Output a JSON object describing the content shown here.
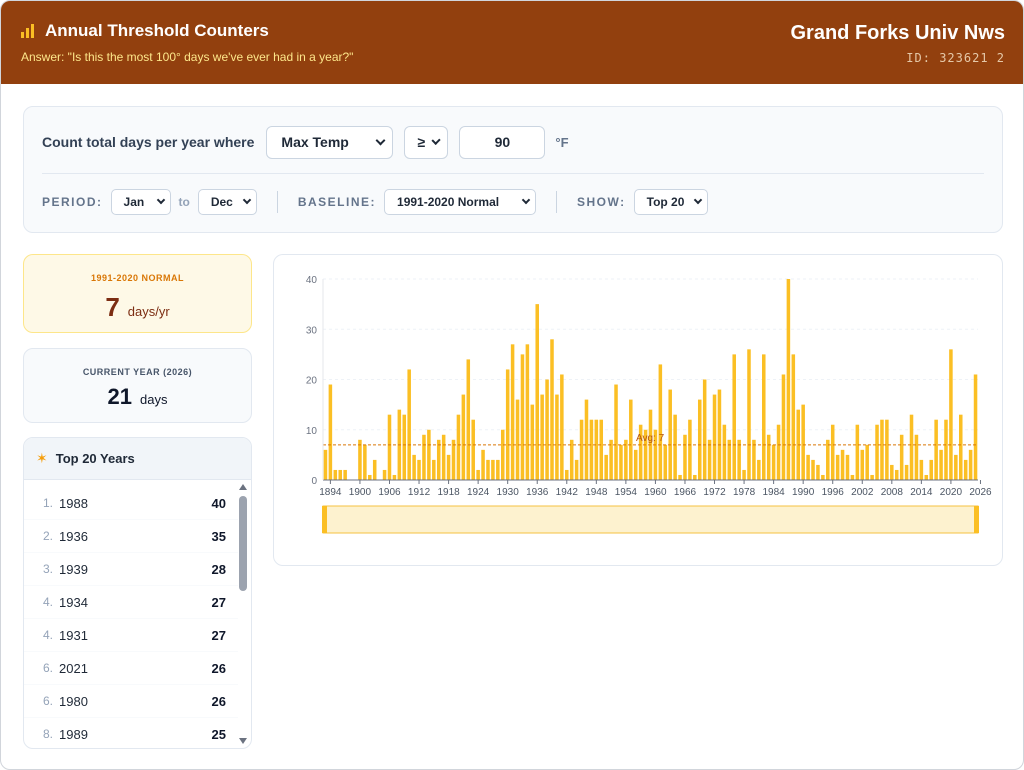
{
  "header": {
    "title": "Annual Threshold Counters",
    "subtitle": "Answer: \"Is this the most 100° days we've ever had in a year?\"",
    "station": "Grand Forks Univ Nws",
    "station_id": "ID: 323621 2"
  },
  "controls": {
    "count_label": "Count total days per year where",
    "element": "Max Temp",
    "operator": "≥",
    "threshold": "90",
    "unit": "°F",
    "period_label": "PERIOD:",
    "period_from": "Jan",
    "to_label": "to",
    "period_to": "Dec",
    "baseline_label": "BASELINE:",
    "baseline": "1991-2020 Normal",
    "show_label": "SHOW:",
    "show": "Top 20"
  },
  "normal_card": {
    "caption": "1991-2020 NORMAL",
    "value": "7",
    "unit": "days/yr"
  },
  "current_card": {
    "caption": "CURRENT YEAR (2026)",
    "value": "21",
    "unit": "days"
  },
  "top_list": {
    "title": "Top 20 Years",
    "items": [
      {
        "rank": "1.",
        "year": "1988",
        "count": "40"
      },
      {
        "rank": "2.",
        "year": "1936",
        "count": "35"
      },
      {
        "rank": "3.",
        "year": "1939",
        "count": "28"
      },
      {
        "rank": "4.",
        "year": "1934",
        "count": "27"
      },
      {
        "rank": "4.",
        "year": "1931",
        "count": "27"
      },
      {
        "rank": "6.",
        "year": "2021",
        "count": "26"
      },
      {
        "rank": "6.",
        "year": "1980",
        "count": "26"
      },
      {
        "rank": "8.",
        "year": "1989",
        "count": "25"
      }
    ]
  },
  "colors": {
    "header": "#92400e",
    "bar": "#fbbf24",
    "normal_line": "#d97706"
  },
  "chart_data": {
    "type": "bar",
    "x_start": 1893,
    "x_end": 2026,
    "xticks": [
      "1894",
      "1900",
      "1906",
      "1912",
      "1918",
      "1924",
      "1930",
      "1936",
      "1942",
      "1948",
      "1954",
      "1960",
      "1966",
      "1972",
      "1978",
      "1984",
      "1990",
      "1996",
      "2002",
      "2008",
      "2014",
      "2020",
      "2026"
    ],
    "yticks": [
      "0",
      "10",
      "20",
      "30",
      "40"
    ],
    "ylim": [
      0,
      40
    ],
    "normal_value": 7,
    "normal_label": "Avg: 7",
    "values": [
      6,
      19,
      2,
      2,
      2,
      0,
      0,
      8,
      7,
      1,
      4,
      0,
      2,
      13,
      1,
      14,
      13,
      22,
      5,
      4,
      9,
      10,
      4,
      8,
      9,
      5,
      8,
      13,
      17,
      24,
      12,
      2,
      6,
      4,
      4,
      4,
      10,
      22,
      27,
      16,
      25,
      27,
      15,
      35,
      17,
      20,
      28,
      17,
      21,
      2,
      8,
      4,
      12,
      16,
      12,
      12,
      12,
      5,
      8,
      19,
      7,
      8,
      16,
      6,
      11,
      10,
      14,
      10,
      23,
      7,
      18,
      13,
      1,
      9,
      12,
      1,
      16,
      20,
      8,
      17,
      18,
      11,
      8,
      25,
      8,
      2,
      26,
      8,
      4,
      25,
      9,
      7,
      11,
      21,
      40,
      25,
      14,
      15,
      5,
      4,
      3,
      1,
      8,
      11,
      5,
      6,
      5,
      1,
      11,
      6,
      7,
      1,
      11,
      12,
      12,
      3,
      2,
      9,
      3,
      13,
      9,
      4,
      1,
      4,
      12,
      6,
      12,
      26,
      5,
      13,
      4,
      6,
      21
    ]
  }
}
